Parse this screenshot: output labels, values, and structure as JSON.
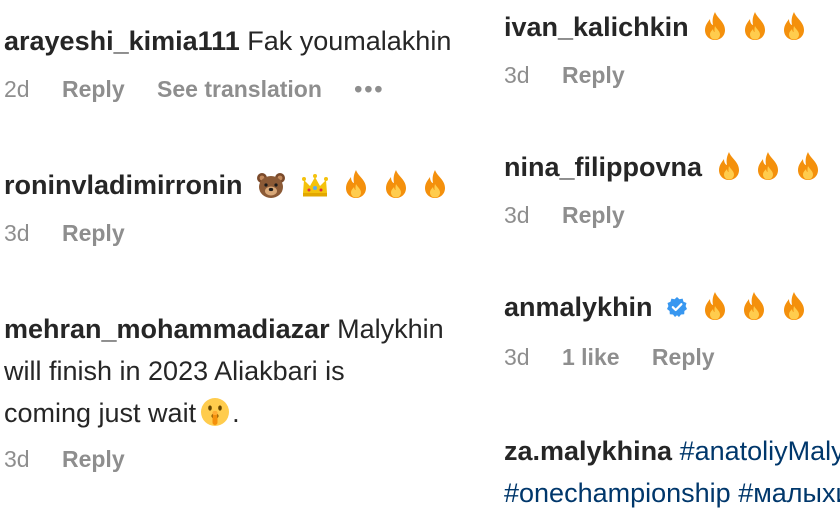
{
  "left_comments": [
    {
      "username": "arayeshi_kimia111",
      "text": "Fak youmalakhin",
      "age": "2d",
      "reply": "Reply",
      "see_translation": "See translation",
      "more": "•••"
    },
    {
      "username": "roninvladimirronin",
      "emojis": [
        "bear-face-icon",
        "crown-icon",
        "fire-icon",
        "fire-icon",
        "fire-icon"
      ],
      "age": "3d",
      "reply": "Reply"
    },
    {
      "username": "mehran_mohammadiazar",
      "text_line1": "Malykhin",
      "text_line2": "will finish in 2023 Aliakbari is",
      "text_line3": "coming just wait",
      "text_end": ".",
      "emojis": [
        "shushing-face-icon"
      ],
      "age": "3d",
      "reply": "Reply"
    }
  ],
  "right_comments": [
    {
      "username": "ivan_kalichkin",
      "emojis": [
        "fire-icon",
        "fire-icon",
        "fire-icon"
      ],
      "age": "3d",
      "reply": "Reply"
    },
    {
      "username": "nina_filippovna",
      "emojis": [
        "fire-icon",
        "fire-icon",
        "fire-icon"
      ],
      "age": "3d",
      "reply": "Reply"
    },
    {
      "username": "anmalykhin",
      "verified": true,
      "emojis": [
        "fire-icon",
        "fire-icon",
        "fire-icon"
      ],
      "age": "3d",
      "likes": "1 like",
      "reply": "Reply"
    },
    {
      "username": "za.malykhina",
      "hashtag1": "#anatoliyMalykhin",
      "hashtag2": "#onechampionship",
      "hashtag3": "#малыхин"
    }
  ],
  "colors": {
    "text": "#262626",
    "meta": "#8e8e8e",
    "hashtag": "#00376b",
    "verified": "#3897f0",
    "fire": "#f4900c"
  }
}
